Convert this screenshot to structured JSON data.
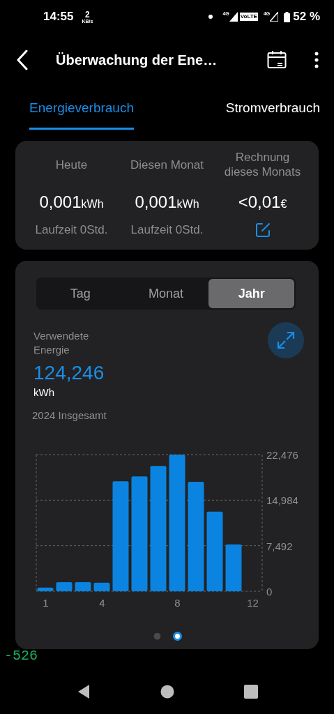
{
  "status_bar": {
    "time": "14:55",
    "speed_value": "2",
    "speed_unit": "KB/s",
    "network_1": "4G",
    "volte": "VoLTE",
    "network_2": "4G",
    "battery": "52 %"
  },
  "app_bar": {
    "title": "Überwachung der Ene…"
  },
  "tabs": [
    {
      "label": "Energieverbrauch",
      "selected": true
    },
    {
      "label": "Stromverbrauch",
      "selected": false
    }
  ],
  "summary": [
    {
      "label": "Heute",
      "value": "0,001",
      "unit": "kWh",
      "footer": "Laufzeit 0Std.",
      "kind": "text"
    },
    {
      "label": "Diesen Monat",
      "value": "0,001",
      "unit": "kWh",
      "footer": "Laufzeit 0Std.",
      "kind": "text"
    },
    {
      "label": "Rechnung dieses Monats",
      "value": "<0,01",
      "unit": "€",
      "kind": "edit"
    }
  ],
  "period_tabs": [
    {
      "label": "Tag",
      "selected": false
    },
    {
      "label": "Monat",
      "selected": false
    },
    {
      "label": "Jahr",
      "selected": true
    }
  ],
  "energy": {
    "label": "Verwendete Energie",
    "value": "124,246",
    "unit": "kWh",
    "caption": "2024 Insgesamt",
    "chart_data": {
      "type": "bar",
      "categories": [
        "1",
        null,
        null,
        "4",
        null,
        null,
        null,
        "8",
        null,
        null,
        null,
        "12"
      ],
      "series": [
        {
          "color": "#0a84e0",
          "values": [
            0.6,
            1.5,
            1.5,
            1.4,
            18.1,
            18.9,
            20.6,
            22.476,
            18.0,
            13.1,
            7.7,
            null
          ]
        }
      ],
      "ylim": [
        0,
        22.476
      ],
      "yticks": [
        {
          "value": 0,
          "label": "0"
        },
        {
          "value": 7.492,
          "label": "7,492"
        },
        {
          "value": 14.984,
          "label": "14,984"
        },
        {
          "value": 22.476,
          "label": "22,476"
        }
      ]
    }
  },
  "pager": [
    {
      "selected": false
    },
    {
      "selected": true
    }
  ],
  "debug_overlay": "-526"
}
